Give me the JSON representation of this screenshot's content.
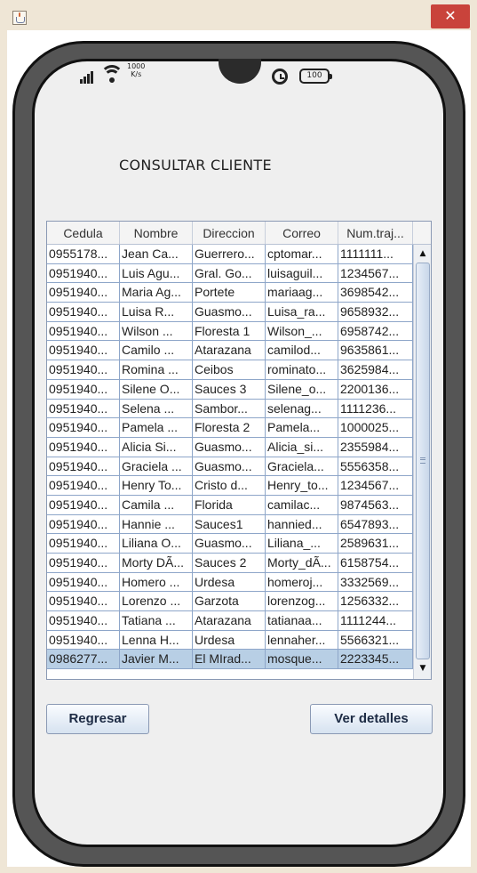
{
  "window": {
    "close_glyph": "✕"
  },
  "status_bar": {
    "speed_value": "1000",
    "speed_unit": "K/s",
    "battery": "100"
  },
  "screen": {
    "title": "CONSULTAR CLIENTE"
  },
  "table": {
    "columns": [
      "Cedula",
      "Nombre",
      "Direccion",
      "Correo",
      "Num.traj..."
    ],
    "rows": [
      [
        "0955178...",
        "Jean Ca...",
        "Guerrero...",
        "cptomar...",
        "1111111..."
      ],
      [
        "0951940...",
        "Luis Agu...",
        "Gral. Go...",
        "luisaguil...",
        "1234567..."
      ],
      [
        "0951940...",
        "Maria Ag...",
        "Portete",
        "mariaag...",
        "3698542..."
      ],
      [
        "0951940...",
        "Luisa R...",
        "Guasmo...",
        "Luisa_ra...",
        "9658932..."
      ],
      [
        "0951940...",
        "Wilson ...",
        "Floresta 1",
        "Wilson_...",
        "6958742..."
      ],
      [
        "0951940...",
        "Camilo ...",
        "Atarazana",
        "camilod...",
        "9635861..."
      ],
      [
        "0951940...",
        "Romina ...",
        "Ceibos",
        "rominato...",
        "3625984..."
      ],
      [
        "0951940...",
        "Silene O...",
        "Sauces 3",
        "Silene_o...",
        "2200136..."
      ],
      [
        "0951940...",
        "Selena ...",
        "Sambor...",
        "selenag...",
        "1111236..."
      ],
      [
        "0951940...",
        "Pamela ...",
        "Floresta 2",
        "Pamela...",
        "1000025..."
      ],
      [
        "0951940...",
        "Alicia Si...",
        "Guasmo...",
        "Alicia_si...",
        "2355984..."
      ],
      [
        "0951940...",
        "Graciela ...",
        "Guasmo...",
        "Graciela...",
        "5556358..."
      ],
      [
        "0951940...",
        "Henry To...",
        "Cristo d...",
        "Henry_to...",
        "1234567..."
      ],
      [
        "0951940...",
        "Camila ...",
        "Florida",
        "camilac...",
        "9874563..."
      ],
      [
        "0951940...",
        "Hannie ...",
        "Sauces1",
        "hannied...",
        "6547893..."
      ],
      [
        "0951940...",
        "Liliana O...",
        "Guasmo...",
        "Liliana_...",
        "2589631..."
      ],
      [
        "0951940...",
        "Morty DÃ...",
        "Sauces 2",
        "Morty_dÃ...",
        "6158754..."
      ],
      [
        "0951940...",
        "Homero ...",
        "Urdesa",
        "homeroj...",
        "3332569..."
      ],
      [
        "0951940...",
        "Lorenzo ...",
        "Garzota",
        "lorenzog...",
        "1256332..."
      ],
      [
        "0951940...",
        "Tatiana ...",
        "Atarazana",
        "tatianaa...",
        "1111244..."
      ],
      [
        "0951940...",
        "Lenna H...",
        "Urdesa",
        "lennaher...",
        "5566321..."
      ],
      [
        "0986277...",
        "Javier M...",
        "El MIrad...",
        "mosque...",
        "2223345..."
      ]
    ],
    "selected_row": 21
  },
  "buttons": {
    "back": "Regresar",
    "details": "Ver detalles"
  }
}
